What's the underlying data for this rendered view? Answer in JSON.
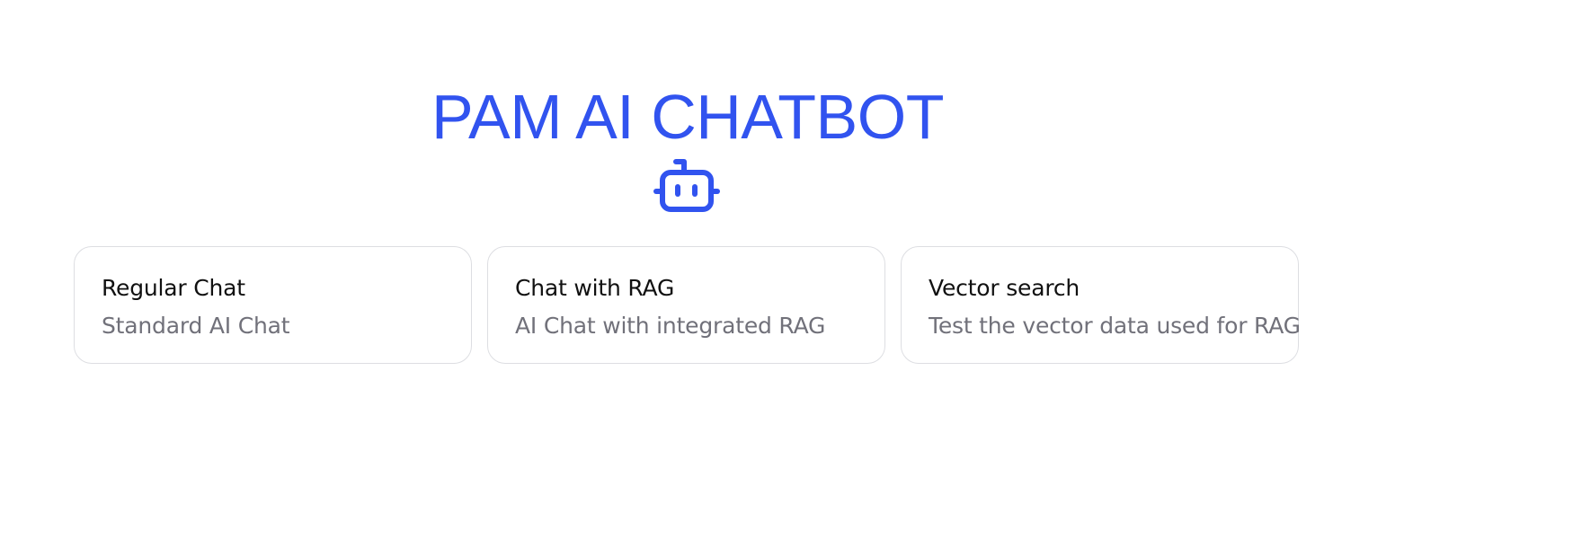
{
  "header": {
    "title": "PAM AI CHATBOT",
    "icon": "bot-icon",
    "accent_color": "#3153ef"
  },
  "cards": [
    {
      "title": "Regular Chat",
      "description": "Standard AI Chat"
    },
    {
      "title": "Chat with RAG",
      "description": "AI Chat with integrated RAG"
    },
    {
      "title": "Vector search",
      "description": "Test the vector data used for RAG"
    }
  ]
}
